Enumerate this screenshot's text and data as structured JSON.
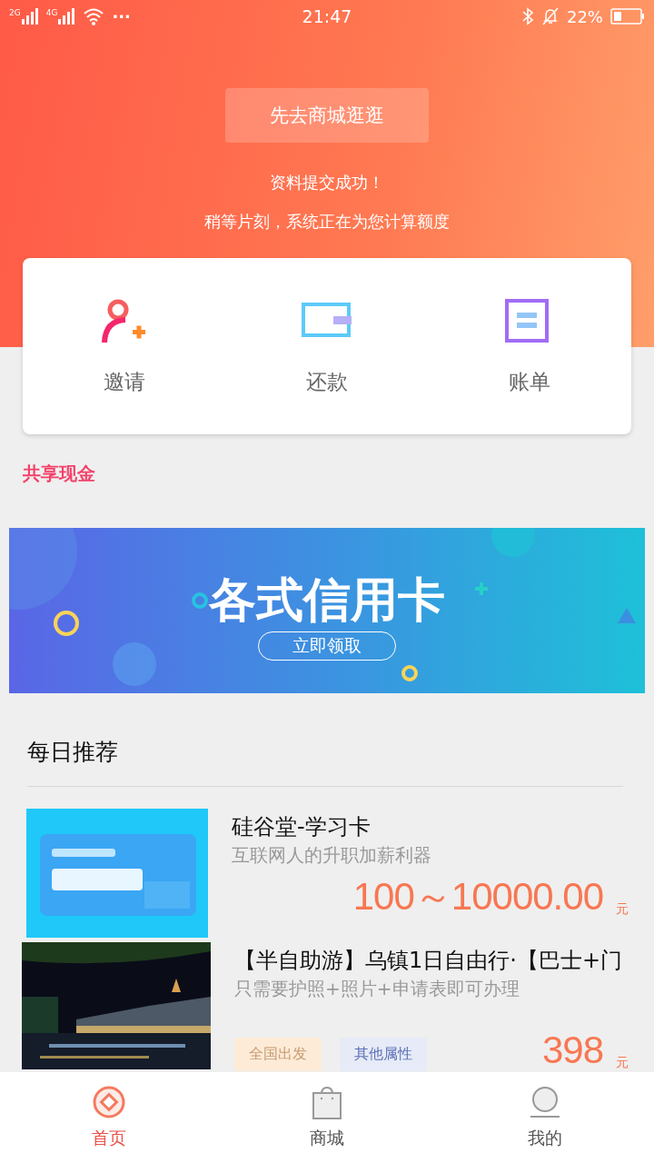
{
  "status_bar": {
    "networks": [
      "2G",
      "4G"
    ],
    "more": "···",
    "time": "21:47",
    "battery_text": "22%"
  },
  "header": {
    "shop_button": "先去商城逛逛",
    "messages": [
      "资料提交成功！",
      "稍等片刻，系统正在为您计算额度"
    ]
  },
  "quick_actions": [
    {
      "kind": "invite",
      "label": "邀请"
    },
    {
      "kind": "repay",
      "label": "还款"
    },
    {
      "kind": "bill",
      "label": "账单"
    }
  ],
  "section_title": "共享现金",
  "banner": {
    "title": "各式信用卡",
    "button": "立即领取"
  },
  "recommend": {
    "title": "每日推荐",
    "items": [
      {
        "kind": "picture",
        "title": "硅谷堂-学习卡",
        "subtitle": "互联网人的升职加薪利器",
        "price": "100～10000.00",
        "unit": "元"
      },
      {
        "kind": "picture",
        "title": "【半自助游】乌镇1日自由行·【巴士+门",
        "subtitle": "只需要护照+照片+申请表即可办理",
        "tags": [
          {
            "label": "全国出发",
            "color": "#fdebd8"
          },
          {
            "label": "其他属性",
            "color": "#e6ebf7"
          }
        ],
        "price": "398",
        "unit": "元"
      }
    ]
  },
  "tab_bar": [
    {
      "kind": "home",
      "label": "首页",
      "selected": true
    },
    {
      "kind": "shop",
      "label": "商城",
      "selected": false
    },
    {
      "kind": "mine",
      "label": "我的",
      "selected": false
    }
  ]
}
